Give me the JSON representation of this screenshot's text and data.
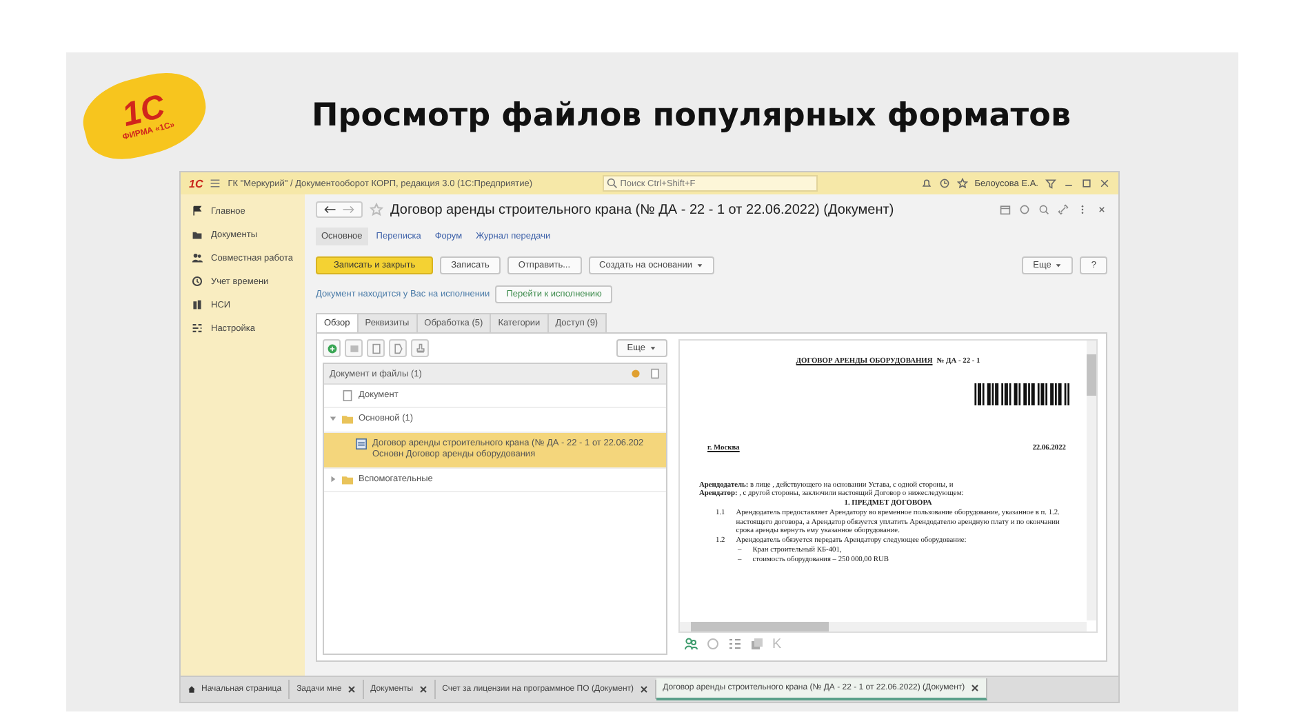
{
  "slide": {
    "title": "Просмотр файлов популярных форматов",
    "logo": {
      "mark": "1С",
      "caption": "ФИРМА «1С»"
    }
  },
  "app": {
    "title_bar": {
      "logo": "1С",
      "title": "ГК \"Меркурий\" / Документооборот КОРП, редакция 3.0 (1С:Предприятие)",
      "search_placeholder": "Поиск Ctrl+Shift+F",
      "user": "Белоусова Е.А."
    },
    "sidebar": [
      {
        "label": "Главное",
        "kind": "flag"
      },
      {
        "label": "Документы",
        "kind": "documents"
      },
      {
        "label": "Совместная работа",
        "kind": "team"
      },
      {
        "label": "Учет времени",
        "kind": "clock"
      },
      {
        "label": "НСИ",
        "kind": "books"
      },
      {
        "label": "Настройка",
        "kind": "settings"
      }
    ],
    "document_title": "Договор аренды строительного крана (№ ДА - 22 - 1 от 22.06.2022) (Документ)",
    "sections": [
      {
        "label": "Основное",
        "selected": true
      },
      {
        "label": "Переписка",
        "selected": false
      },
      {
        "label": "Форум",
        "selected": false
      },
      {
        "label": "Журнал передачи",
        "selected": false
      }
    ],
    "actions": [
      {
        "label": "Записать и закрыть",
        "kind": "primary"
      },
      {
        "label": "Записать",
        "kind": "plain"
      },
      {
        "label": "Отправить...",
        "kind": "plain"
      },
      {
        "label": "Создать на основании",
        "kind": "dropdown"
      }
    ],
    "more_button": "Еще",
    "help_button": "?",
    "status_text": "Документ находится у Вас на исполнении",
    "status_button": "Перейти к исполнению",
    "tabs": [
      {
        "label": "Обзор",
        "selected": true
      },
      {
        "label": "Реквизиты",
        "selected": false
      },
      {
        "label": "Обработка (5)",
        "selected": false
      },
      {
        "label": "Категории",
        "selected": false
      },
      {
        "label": "Доступ (9)",
        "selected": false
      }
    ],
    "files": {
      "more_button": "Еще",
      "header": "Документ и файлы (1)",
      "tree": [
        {
          "label": "Документ",
          "kind": "document",
          "selected": false
        },
        {
          "label": "Основной (1)",
          "kind": "folder",
          "selected": false,
          "expanded": true,
          "children": [
            {
              "label": "Договор аренды строительного крана (№ ДА - 22 - 1 от 22.06.202 Основн Договор аренды оборудования",
              "kind": "file",
              "selected": true
            }
          ]
        },
        {
          "label": "Вспомогательные",
          "kind": "folder",
          "selected": false,
          "expanded": false
        }
      ]
    },
    "preview": {
      "doc_title": "ДОГОВОР АРЕНДЫ ОБОРУДОВАНИЯ",
      "doc_number": "№ ДА - 22 - 1",
      "city": "г. Москва",
      "date": "22.06.2022",
      "paragraphs": [
        {
          "kind": "party",
          "text": "**Арендодатель:** в лице , действующего на основании Устава, с одной стороны, и"
        },
        {
          "kind": "party",
          "text": "**Арендатор:** , с другой стороны, заключили настоящий Договор о нижеследующем:"
        },
        {
          "kind": "heading",
          "text": "1. ПРЕДМЕТ ДОГОВОРА"
        },
        {
          "kind": "numbered",
          "num": "1.1",
          "text": "Арендодатель предоставляет Арендатору во временное пользование оборудование, указанное в п. 1.2. настоящего договора, а Арендатор обязуется уплатить Арендодателю арендную плату и по окончании срока аренды вернуть ему указанное оборудование."
        },
        {
          "kind": "numbered",
          "num": "1.2",
          "text": "Арендодатель обязуется передать Арендатору следующее оборудование:"
        },
        {
          "kind": "bullet",
          "num": "–",
          "text": "Кран строительный КБ-401,"
        },
        {
          "kind": "bullet",
          "num": "–",
          "text": "стоимость оборудования – 250 000,00 RUB"
        }
      ],
      "tool_letter": "K"
    },
    "taskbar": [
      {
        "label": "Начальная страница",
        "kind": "home",
        "selected": false
      },
      {
        "label": "Задачи мне",
        "kind": "tab",
        "selected": false
      },
      {
        "label": "Документы",
        "kind": "tab",
        "selected": false
      },
      {
        "label": "Счет за лицензии на программное ПО (Документ)",
        "kind": "tab",
        "selected": false
      },
      {
        "label": "Договор аренды строительного крана (№ ДА - 22 - 1 от 22.06.2022) (Документ)",
        "kind": "tab",
        "selected": true
      }
    ]
  }
}
